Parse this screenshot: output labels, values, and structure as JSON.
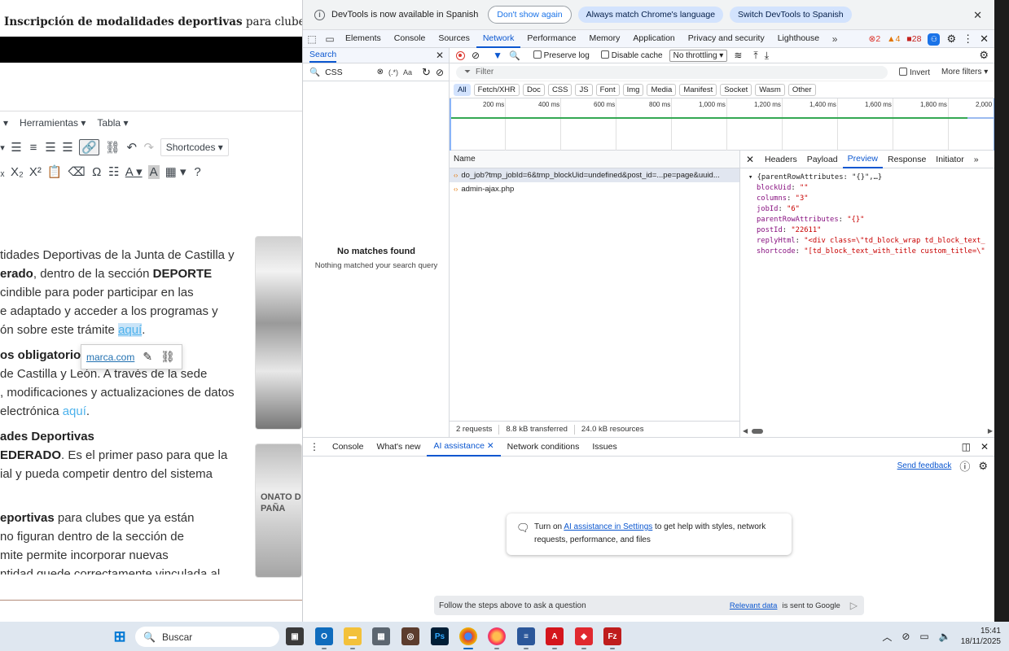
{
  "editor": {
    "title_bold": "Inscripción de modalidades deportivas",
    "title_rest": " para clubes que ya",
    "menu": [
      "▾",
      "Herramientas ▾",
      "Tabla ▾"
    ],
    "shortcodes_label": "Shortcodes ▾",
    "paragraphs": [
      {
        "pre": "tidades Deportivas de la Junta de Castilla y",
        "bold": "",
        "post": "",
        "link": ""
      },
      {
        "pre": "",
        "bold": "erado",
        "post": ", dentro de la sección ",
        "bold2": "DEPORTE"
      },
      {
        "pre": "cindible para poder participar en las"
      },
      {
        "pre": "e adaptado y acceder a los programas y"
      },
      {
        "pre": "ón sobre este trámite ",
        "link": "aquí",
        "post": "."
      }
    ],
    "para2": [
      {
        "bold": "os obligatorio"
      },
      {
        "pre": "de Castilla y León. A través de la sede"
      },
      {
        "pre": ", modificaciones y actualizaciones de datos"
      },
      {
        "pre": "electrónica ",
        "link": "aquí",
        "post": "."
      }
    ],
    "para3": [
      {
        "bold": "ades Deportivas"
      },
      {
        "bold": "EDERADO",
        "post": ". Es el primer paso para que la"
      },
      {
        "pre": "ial y pueda competir dentro del sistema"
      }
    ],
    "para4": [
      {
        "bold": "eportivas",
        "post": " para clubes que ya están"
      },
      {
        "pre": "no figuran dentro de la sección de"
      },
      {
        "pre": "mite permite incorporar nuevas"
      },
      {
        "pre": "ntidad quede correctamente vinculada al"
      }
    ],
    "link_popup_url": "marca.com",
    "image2_text": "ONATO DE\nPAÑA"
  },
  "devtools": {
    "infobar": {
      "message": "DevTools is now available in Spanish",
      "btn_dont_show": "Don't show again",
      "btn_match": "Always match Chrome's language",
      "btn_switch": "Switch DevTools to Spanish"
    },
    "tabs": [
      "Elements",
      "Console",
      "Sources",
      "Network",
      "Performance",
      "Memory",
      "Application",
      "Privacy and security",
      "Lighthouse"
    ],
    "active_tab": "Network",
    "errors": "2",
    "warnings": "4",
    "issues": "28",
    "search": {
      "title": "Search",
      "query": "CSS",
      "regex": "(.*)",
      "case": "Aa",
      "no_match_title": "No matches found",
      "no_match_desc": "Nothing matched your search query"
    },
    "network": {
      "preserve_log": "Preserve log",
      "disable_cache": "Disable cache",
      "throttling": "No throttling",
      "filter_placeholder": "Filter",
      "invert": "Invert",
      "more_filters": "More filters ▾",
      "types": [
        "All",
        "Fetch/XHR",
        "Doc",
        "CSS",
        "JS",
        "Font",
        "Img",
        "Media",
        "Manifest",
        "Socket",
        "Wasm",
        "Other"
      ],
      "timeline_ticks": [
        "200 ms",
        "400 ms",
        "600 ms",
        "800 ms",
        "1,000 ms",
        "1,200 ms",
        "1,400 ms",
        "1,600 ms",
        "1,800 ms",
        "2,000"
      ],
      "name_header": "Name",
      "requests": [
        "do_job?tmp_jobId=6&tmp_blockUid=undefined&post_id=...pe=page&uuid...",
        "admin-ajax.php"
      ],
      "status": {
        "requests": "2 requests",
        "transferred": "8.8 kB transferred",
        "resources": "24.0 kB resources"
      },
      "detail_tabs": [
        "Headers",
        "Payload",
        "Preview",
        "Response",
        "Initiator"
      ],
      "active_detail": "Preview",
      "preview": {
        "root": "{parentRowAttributes: \"{}\",…}",
        "fields": [
          {
            "k": "blockUid",
            "v": "\"\""
          },
          {
            "k": "columns",
            "v": "\"3\""
          },
          {
            "k": "jobId",
            "v": "\"6\""
          },
          {
            "k": "parentRowAttributes",
            "v": "\"{}\""
          },
          {
            "k": "postId",
            "v": "\"22611\""
          },
          {
            "k": "replyHtml",
            "v": "\"<div class=\\\"td_block_wrap td_block_text_"
          },
          {
            "k": "shortcode",
            "v": "\"[td_block_text_with_title custom_title=\\\""
          }
        ]
      }
    },
    "drawer": {
      "tabs": [
        "Console",
        "What's new",
        "AI assistance",
        "Network conditions",
        "Issues"
      ],
      "active": "AI assistance",
      "send_feedback": "Send feedback",
      "card_pre": "Turn on ",
      "card_link": "AI assistance in Settings",
      "card_post": " to get help with styles, network requests, performance, and files",
      "input_placeholder": "Follow the steps above to ask a question",
      "relevant_link": "Relevant data",
      "relevant_post": " is sent to Google"
    }
  },
  "taskbar": {
    "search": "Buscar",
    "time": "15:41",
    "date": "18/11/2025"
  }
}
